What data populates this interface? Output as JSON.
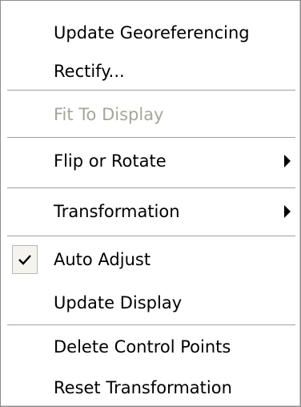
{
  "menu": {
    "items": [
      {
        "label": "Update Georeferencing",
        "enabled": true
      },
      {
        "label": "Rectify...",
        "enabled": true
      },
      {
        "label": "Fit To Display",
        "enabled": false
      },
      {
        "label": "Flip or Rotate",
        "enabled": true,
        "submenu": true
      },
      {
        "label": "Transformation",
        "enabled": true,
        "submenu": true
      },
      {
        "label": "Auto Adjust",
        "enabled": true,
        "checked": true
      },
      {
        "label": "Update Display",
        "enabled": true
      },
      {
        "label": "Delete Control Points",
        "enabled": true
      },
      {
        "label": "Reset Transformation",
        "enabled": true
      }
    ],
    "icons": {
      "submenu": "chevron-right-icon",
      "check": "checkmark-icon"
    },
    "colors": {
      "background": "#ffffff",
      "disabled_text": "#a7a69a",
      "separator": "#a0a0a0"
    }
  }
}
